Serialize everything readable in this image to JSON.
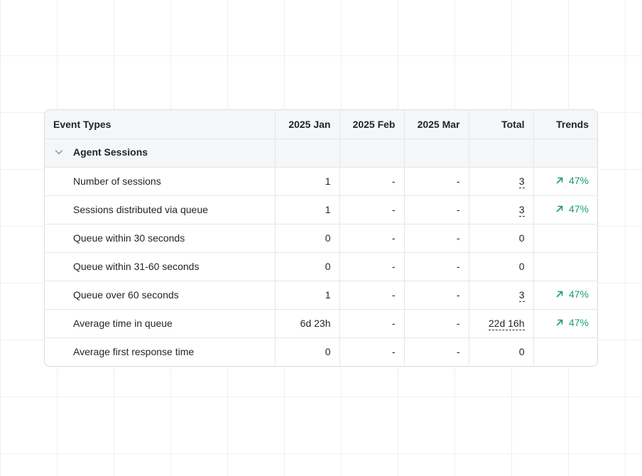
{
  "columns": {
    "event_types": "Event Types",
    "jan": "2025 Jan",
    "feb": "2025 Feb",
    "mar": "2025 Mar",
    "total": "Total",
    "trends": "Trends"
  },
  "group": {
    "label": "Agent Sessions",
    "expanded": true,
    "icon": "chevron-down-icon"
  },
  "rows": [
    {
      "label": "Number of sessions",
      "jan": "1",
      "feb": "-",
      "mar": "-",
      "total": "3",
      "trend": "47%"
    },
    {
      "label": "Sessions distributed via queue",
      "jan": "1",
      "feb": "-",
      "mar": "-",
      "total": "3",
      "trend": "47%"
    },
    {
      "label": "Queue within 30 seconds",
      "jan": "0",
      "feb": "-",
      "mar": "-",
      "total": "0",
      "trend": ""
    },
    {
      "label": "Queue within 31-60 seconds",
      "jan": "0",
      "feb": "-",
      "mar": "-",
      "total": "0",
      "trend": ""
    },
    {
      "label": "Queue over 60 seconds",
      "jan": "1",
      "feb": "-",
      "mar": "-",
      "total": "3",
      "trend": "47%"
    },
    {
      "label": "Average time in queue",
      "jan": "6d 23h",
      "feb": "-",
      "mar": "-",
      "total": "22d 16h",
      "trend": "47%"
    },
    {
      "label": "Average first response time",
      "jan": "0",
      "feb": "-",
      "mar": "-",
      "total": "0",
      "trend": ""
    }
  ],
  "colors": {
    "trend_up": "#1a9e6e",
    "header_bg": "#f5f6f8",
    "border": "#e3e6ea"
  },
  "trend_icon": "arrow-up-right-icon"
}
